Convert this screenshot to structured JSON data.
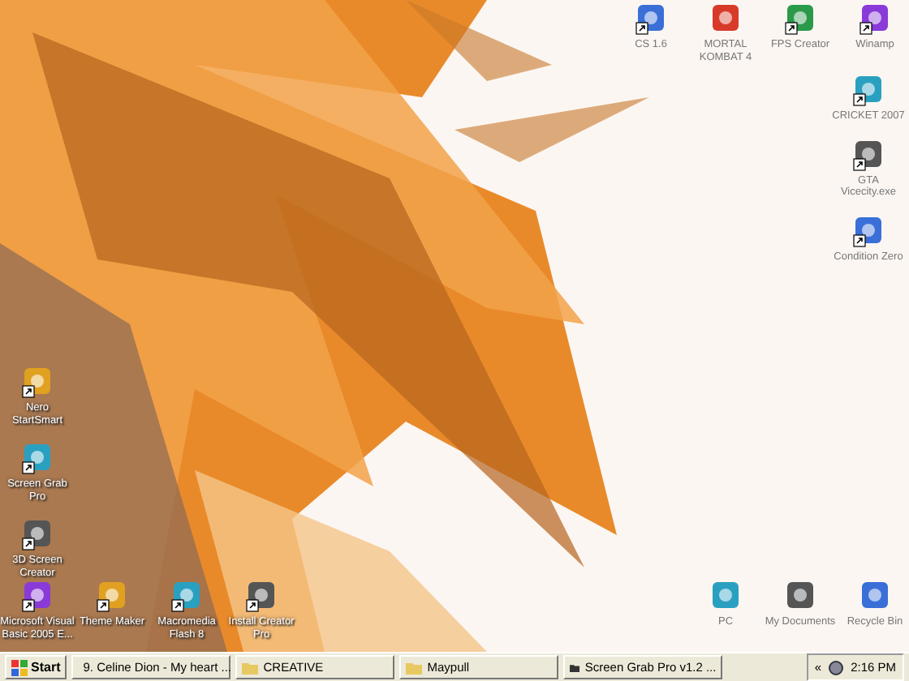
{
  "desktop": {
    "top_row": [
      {
        "label": "CS 1.6",
        "shortcut": true
      },
      {
        "label": "MORTAL KOMBAT 4",
        "shortcut": false
      },
      {
        "label": "FPS Creator",
        "shortcut": true
      },
      {
        "label": "Winamp",
        "shortcut": true
      }
    ],
    "right_column": [
      {
        "label": "CRICKET 2007",
        "shortcut": true
      },
      {
        "label": "GTA Vicecity.exe",
        "shortcut": true
      },
      {
        "label": "Condition Zero",
        "shortcut": true
      }
    ],
    "left_column": [
      {
        "label": "Nero StartSmart",
        "shortcut": true
      },
      {
        "label": "Screen Grab Pro",
        "shortcut": true
      },
      {
        "label": "3D Screen Creator",
        "shortcut": true
      }
    ],
    "bottom_row": [
      {
        "label": "Microsoft Visual Basic 2005 E...",
        "shortcut": true
      },
      {
        "label": "Theme Maker",
        "shortcut": true
      },
      {
        "label": "Macromedia Flash 8",
        "shortcut": true
      },
      {
        "label": "Install Creator Pro",
        "shortcut": true
      }
    ],
    "bottom_right": [
      {
        "label": "PC",
        "shortcut": false
      },
      {
        "label": "My Documents",
        "shortcut": false
      },
      {
        "label": "Recycle Bin",
        "shortcut": false
      }
    ]
  },
  "taskbar": {
    "start": "Start",
    "windows": [
      {
        "label": "9. Celine Dion - My heart ...",
        "selected": false
      },
      {
        "label": "CREATIVE",
        "selected": false
      },
      {
        "label": "Maypull",
        "selected": false
      },
      {
        "label": "Screen Grab Pro v1.2 ...",
        "selected": false
      }
    ],
    "tray": {
      "chevron": "«",
      "time": "2:16 PM"
    }
  }
}
